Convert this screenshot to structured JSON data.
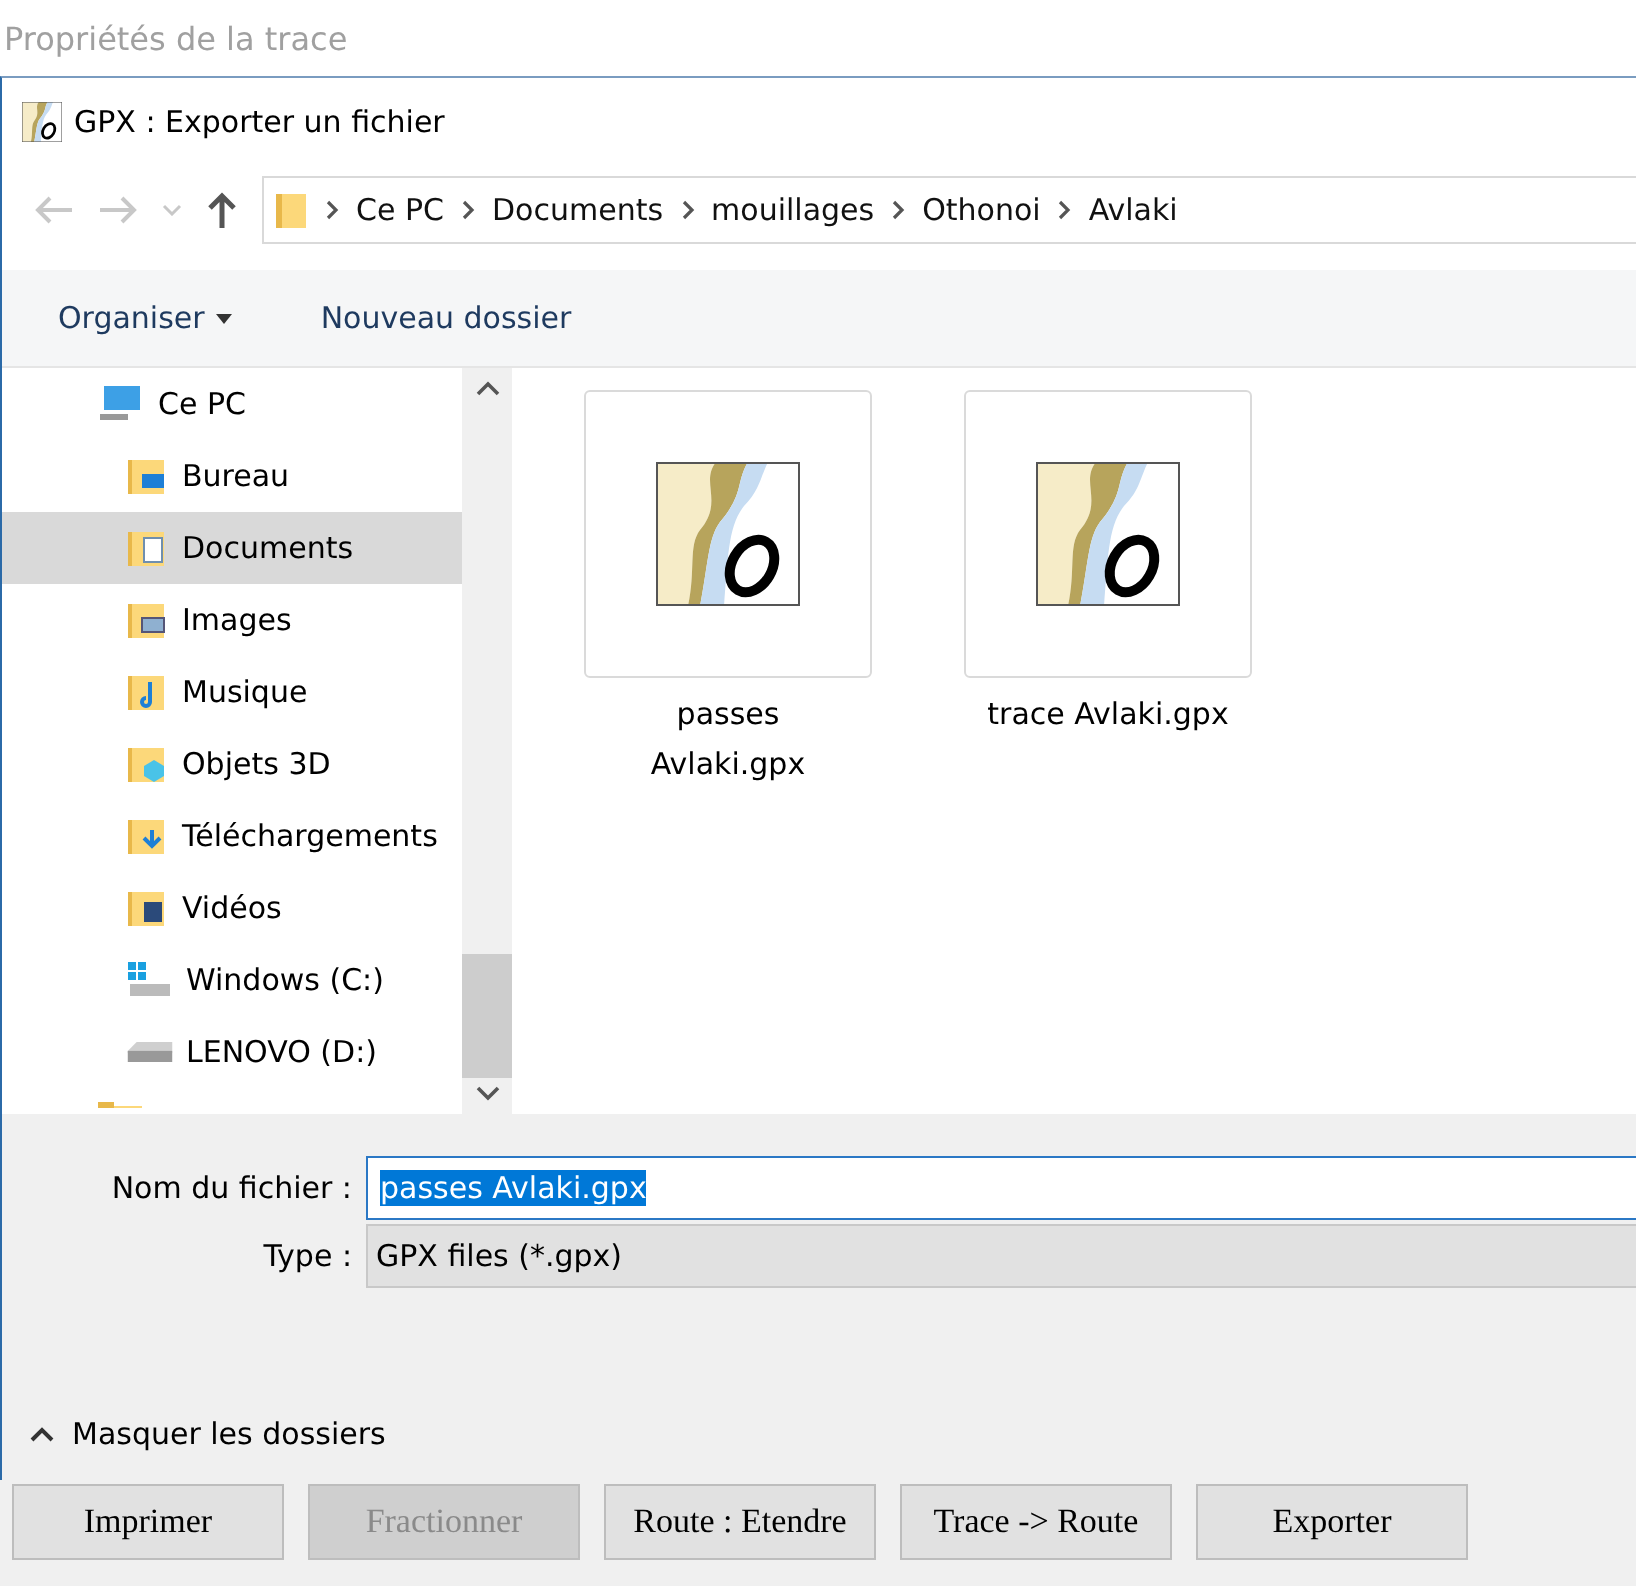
{
  "parent_window": {
    "title": "Propriétés de la trace"
  },
  "dialog": {
    "title": "GPX : Exporter un fichier",
    "breadcrumb": [
      "Ce PC",
      "Documents",
      "mouillages",
      "Othonoi",
      "Avlaki"
    ],
    "toolbar": {
      "organize": "Organiser",
      "new_folder": "Nouveau dossier"
    },
    "sidebar": {
      "items": [
        {
          "label": "Ce PC",
          "kind": "pc",
          "selected": false,
          "children": [
            {
              "label": "Bureau",
              "kind": "desktop",
              "selected": false
            },
            {
              "label": "Documents",
              "kind": "documents",
              "selected": true
            },
            {
              "label": "Images",
              "kind": "pictures",
              "selected": false
            },
            {
              "label": "Musique",
              "kind": "music",
              "selected": false
            },
            {
              "label": "Objets 3D",
              "kind": "objects",
              "selected": false
            },
            {
              "label": "Téléchargements",
              "kind": "downloads",
              "selected": false
            },
            {
              "label": "Vidéos",
              "kind": "videos",
              "selected": false
            },
            {
              "label": "Windows (C:)",
              "kind": "windows_drive",
              "selected": false
            },
            {
              "label": "LENOVO (D:)",
              "kind": "drive",
              "selected": false
            }
          ]
        }
      ]
    },
    "files": [
      {
        "name": "passes Avlaki.gpx",
        "selected": false
      },
      {
        "name": "trace Avlaki.gpx",
        "selected": false
      }
    ],
    "filename": {
      "label": "Nom du fichier :",
      "value": "passes Avlaki.gpx"
    },
    "type": {
      "label": "Type :",
      "value": "GPX files (*.gpx)"
    },
    "hide_folders": "Masquer les dossiers"
  },
  "buttons": [
    {
      "label": "Imprimer",
      "disabled": false
    },
    {
      "label": "Fractionner",
      "disabled": true
    },
    {
      "label": "Route : Etendre",
      "disabled": false
    },
    {
      "label": "Trace -> Route",
      "disabled": false
    },
    {
      "label": "Exporter",
      "disabled": false
    }
  ]
}
